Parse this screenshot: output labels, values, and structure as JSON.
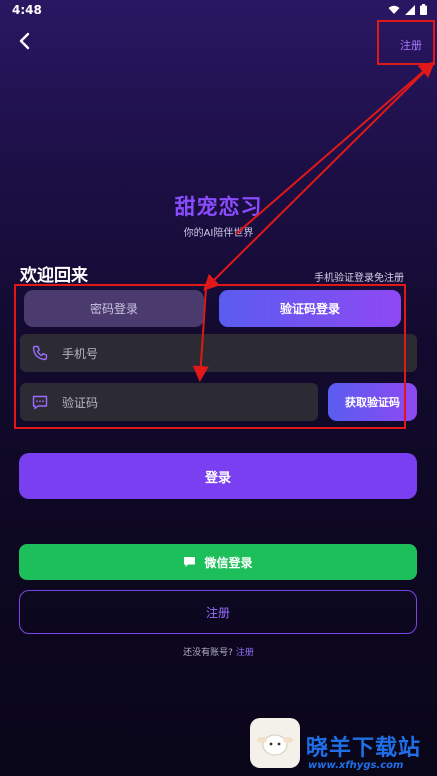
{
  "status_bar": {
    "time": "4:48",
    "icons": [
      "wifi-icon",
      "signal-icon",
      "battery-icon"
    ]
  },
  "header": {
    "back_icon": "chevron-left-icon",
    "register_label": "注册"
  },
  "brand": {
    "title": "甜宠恋习",
    "subtitle": "你的AI陪伴世界"
  },
  "login": {
    "welcome": "欢迎回来",
    "hint": "手机验证登录免注册",
    "tabs": [
      {
        "label": "密码登录",
        "active": false
      },
      {
        "label": "验证码登录",
        "active": true
      }
    ],
    "phone_placeholder": "手机号",
    "code_placeholder": "验证码",
    "get_code_label": "获取验证码",
    "submit_label": "登录"
  },
  "alt_actions": {
    "wechat_label": "微信登录",
    "register_label": "注册",
    "no_account_text": "还没有账号?",
    "no_account_link": "注册"
  },
  "watermark": {
    "text": "晓羊下载站",
    "url": "www.xfhygs.com"
  },
  "colors": {
    "accent": "#7a3ff0",
    "wechat": "#1dbf5a",
    "annotation": "#e01818"
  }
}
